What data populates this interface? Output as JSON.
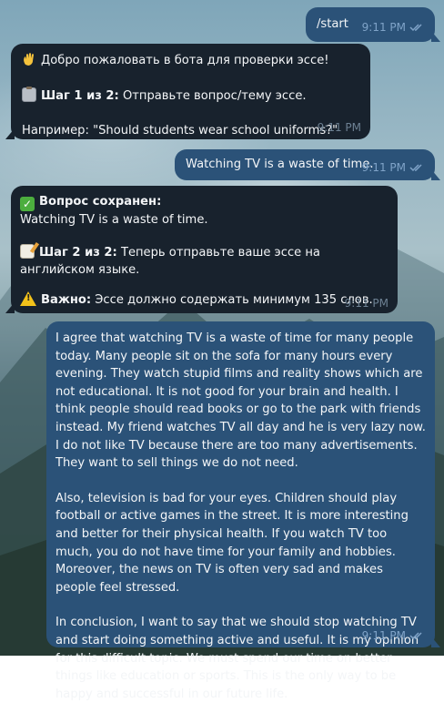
{
  "messages": [
    {
      "id": "m1",
      "side": "out",
      "text": "/start",
      "time": "9:11 PM"
    },
    {
      "id": "m2",
      "side": "in",
      "time": "9:11 PM",
      "lines": {
        "welcome": "Добро пожаловать в бота для проверки эссе!",
        "step_bold": "Шаг 1 из 2:",
        "step_text": " Отправьте вопрос/тему эссе.",
        "example": "Например: \"Should students wear school uniforms?\""
      }
    },
    {
      "id": "m3",
      "side": "out",
      "text": "Watching TV is a waste of time.",
      "time": "9:11 PM"
    },
    {
      "id": "m4",
      "side": "in",
      "time": "9:11 PM",
      "lines": {
        "saved_bold": "Вопрос сохранен:",
        "saved_text": "Watching TV is a waste of time.",
        "step_bold": "Шаг 2 из 2:",
        "step_text": " Теперь отправьте ваше эссе на английском языке.",
        "important_bold": "Важно:",
        "important_text": " Эссе должно содержать минимум 135 слов."
      }
    },
    {
      "id": "m5",
      "side": "out",
      "time": "9:11 PM",
      "paragraphs": [
        "I agree that watching TV is a waste of time for many people today. Many people sit on the sofa for many hours every evening. They watch stupid films and reality shows which are not educational. It is not good for your brain and health. I think people should read books or go to the park with friends instead. My friend watches TV all day and he is very lazy now. I do not like TV because there are too many advertisements. They want to sell things we do not need.",
        "Also, television is bad for your eyes. Children should play football or active games in the street. It is more interesting and better for their physical health. If you watch TV too much, you do not have time for your family and hobbies. Moreover, the news on TV is often very sad and makes people feel stressed.",
        "In conclusion, I want to say that we should stop watching TV and start doing something active and useful. It is my opinion for this difficult topic. We must spend our time on better things like education or sports. This is the only way to be happy and successful in our future life."
      ]
    }
  ]
}
